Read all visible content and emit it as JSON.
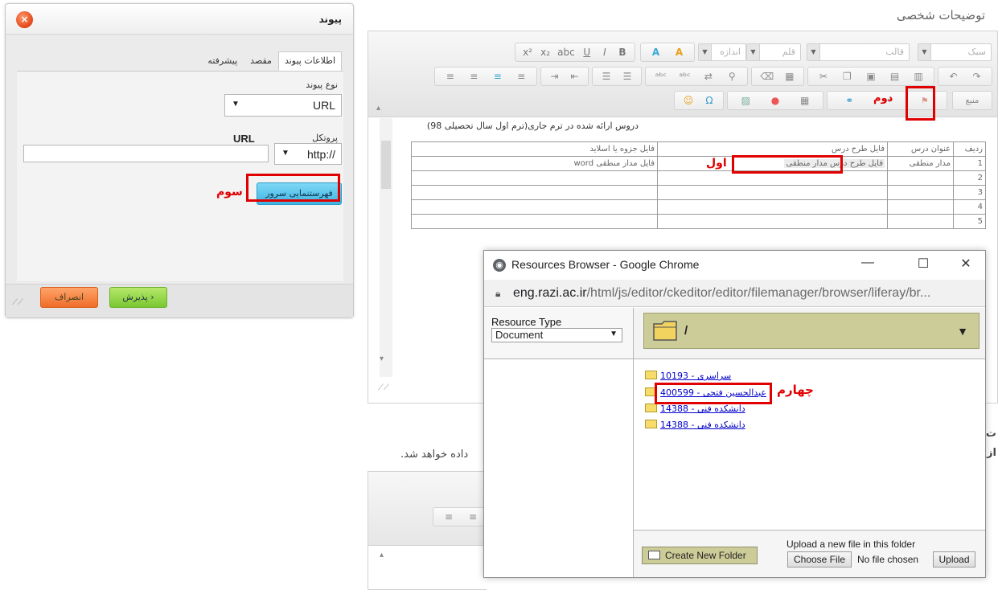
{
  "link_dialog": {
    "title": "پیوند",
    "close_symbol": "×",
    "tabs": [
      "اطلاعات پیوند",
      "مقصد",
      "پیشرفته"
    ],
    "link_type_label": "نوع پیوند",
    "link_type_value": "URL",
    "protocol_label": "پروتکل",
    "protocol_value": "http://",
    "url_label": "URL",
    "url_value": "",
    "browse_server_label": "فهرستنمایی سرور",
    "ok_label": "پذیرش",
    "cancel_label": "انصراف"
  },
  "annotations": {
    "first": "اول",
    "second": "دوم",
    "third": "سوم",
    "fourth": "چهارم"
  },
  "editor": {
    "section_title": "توضیحات شخصی",
    "styles_combo": "سبک",
    "format_combo": "قالب",
    "font_combo": "قلم",
    "size_combo": "اندازه",
    "source_label": "منبع",
    "caption": "دروس ارائه شده در ترم جاری(ترم اول سال تحصیلی 98)",
    "table_headers": [
      "ردیف",
      "عنوان درس",
      "فایل طرح درس",
      "فایل جزوه یا اسلاید"
    ],
    "table_rows": [
      [
        "1",
        "مدار منطقی",
        "فایل طرح درس مدار منطقی",
        "فایل مدار منطقی  word"
      ],
      [
        "2",
        "",
        "",
        ""
      ],
      [
        "3",
        "",
        "",
        ""
      ],
      [
        "4",
        "",
        "",
        ""
      ],
      [
        "5",
        "",
        "",
        ""
      ]
    ]
  },
  "lower": {
    "note_fragment": "داده خواهد شد.",
    "side_letter_1": "ت",
    "side_letter_2": "از"
  },
  "chrome_window": {
    "title": "Resources Browser - Google Chrome",
    "url_host": "eng.razi.ac.ir",
    "url_path": "/html/js/editor/ckeditor/editor/filemanager/browser/liferay/br...",
    "resource_type_label": "Resource Type",
    "resource_type_value": "Document",
    "current_folder": "/",
    "files": [
      "سراسری - 10193",
      "عبدالحسین فتحی - 400599",
      "دانشکده فنی - 14388",
      "دانشکده فنی - 14388"
    ],
    "create_folder_label": "Create New Folder",
    "upload_text": "Upload a new file in this folder",
    "choose_file_label": "Choose File",
    "no_file_text": "No file chosen",
    "upload_label": "Upload"
  }
}
